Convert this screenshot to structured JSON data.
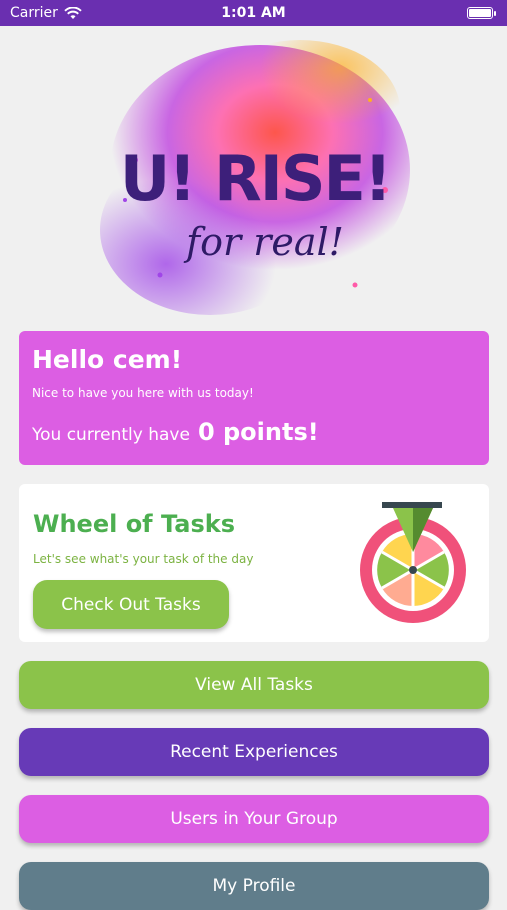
{
  "status_bar": {
    "carrier": "Carrier",
    "time": "1:01 AM",
    "wifi_icon": "wifi-icon",
    "battery_icon": "battery-icon"
  },
  "logo": {
    "title": "U! RISE!",
    "tagline": "for real!"
  },
  "greeting": {
    "title": "Hello cem!",
    "subtitle": "Nice to have you here with us today!",
    "points_label": "You currently have",
    "points_value": "0 points!"
  },
  "wheel": {
    "title": "Wheel of Tasks",
    "subtitle": "Let's see what's your task of the day",
    "button_label": "Check Out Tasks",
    "icon": "wheel-of-fortune-icon"
  },
  "menu": {
    "view_all": "View All Tasks",
    "recent": "Recent Experiences",
    "users": "Users in Your Group",
    "profile": "My Profile"
  },
  "colors": {
    "status_bar": "#6a2fb0",
    "pink": "#dc5ee3",
    "green": "#8bc34a",
    "purple": "#673ab7",
    "slate": "#607d8b"
  }
}
